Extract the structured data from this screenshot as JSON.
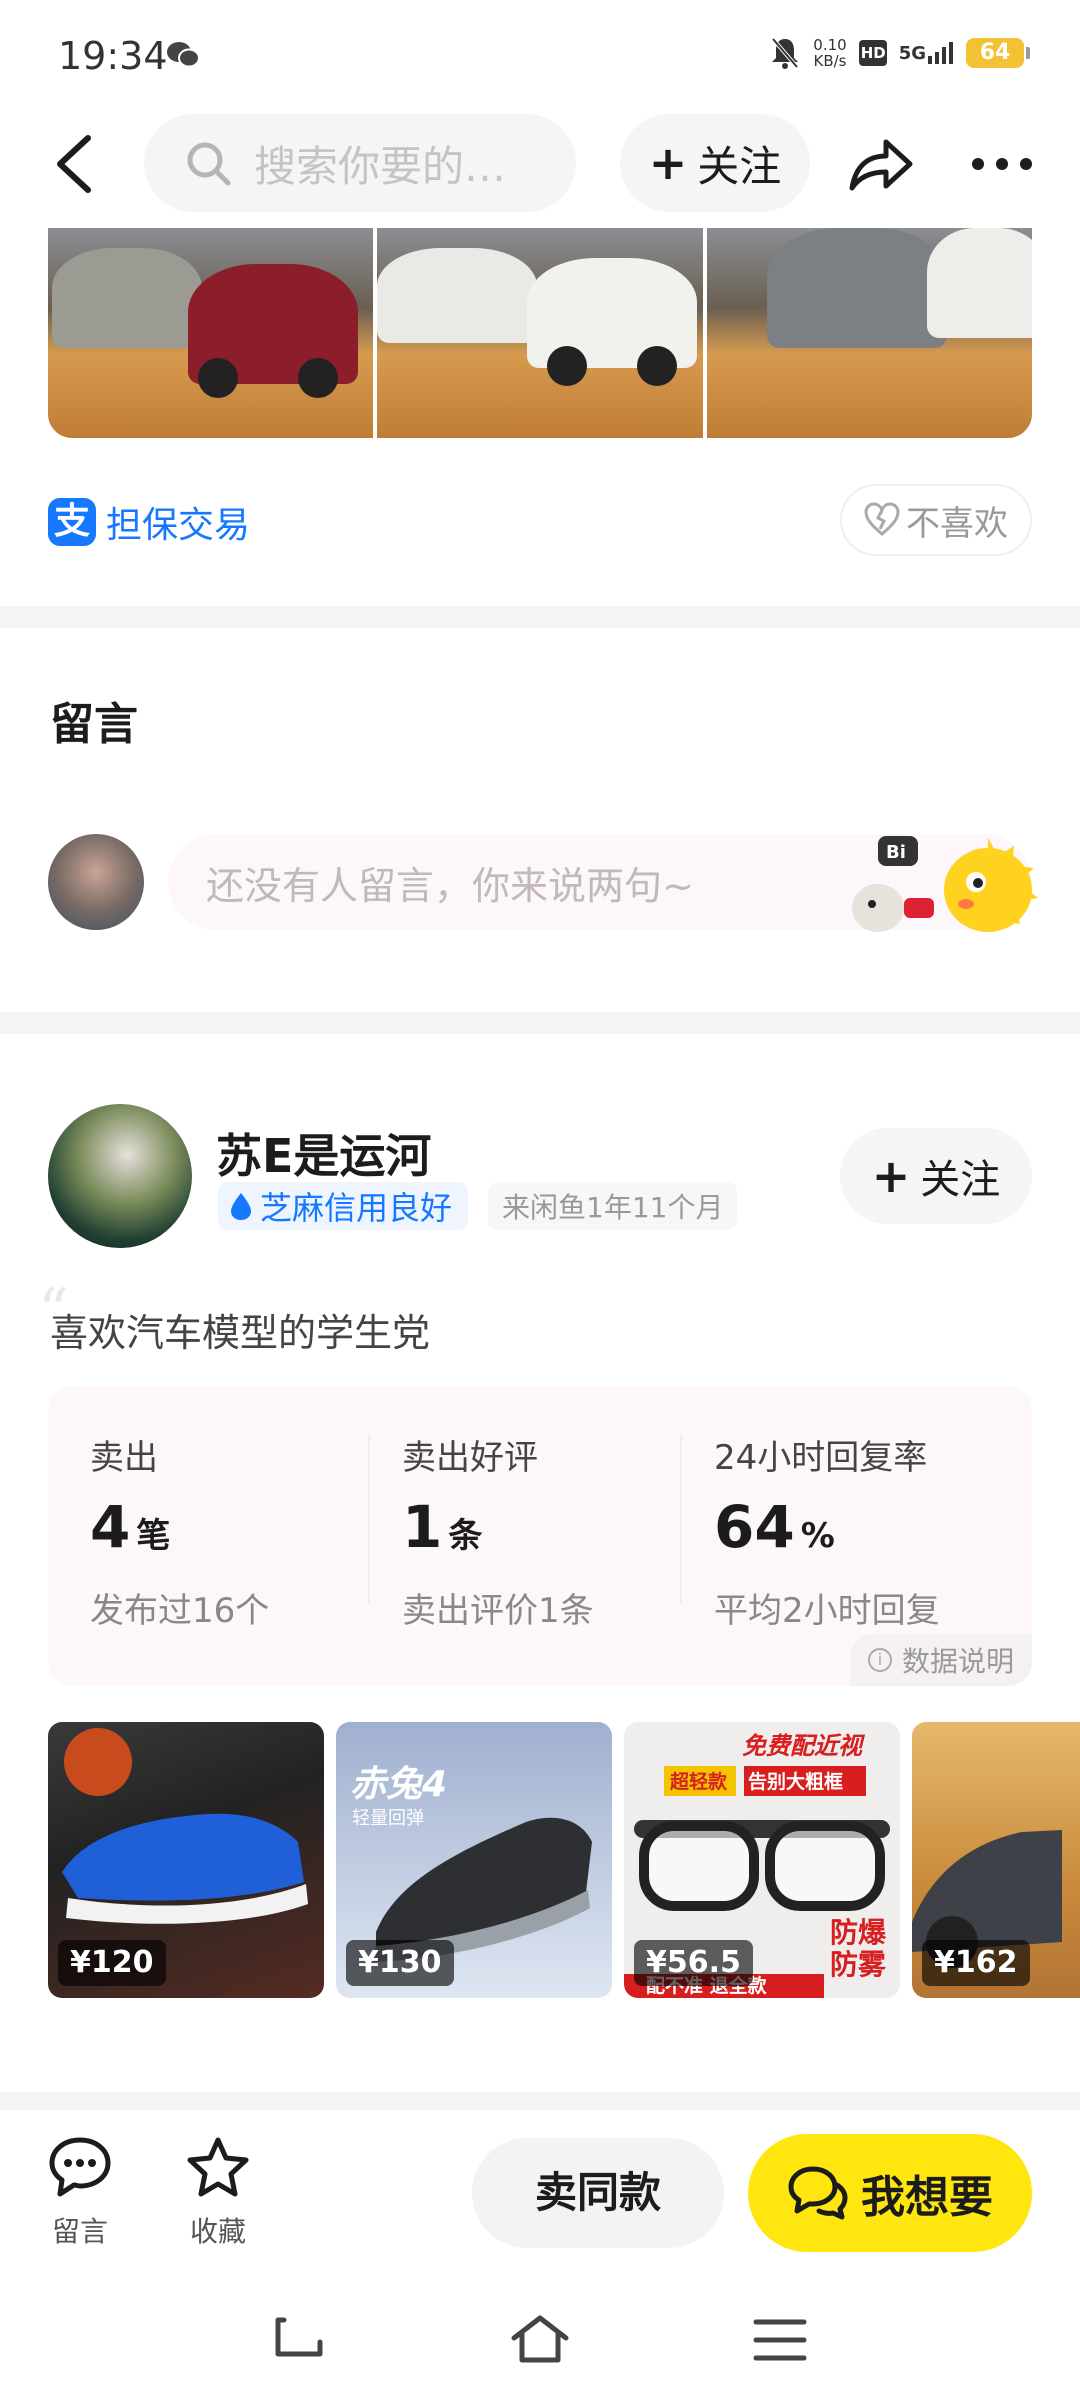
{
  "status": {
    "time": "19:34",
    "speed_top": "0.10",
    "speed_unit": "KB/s",
    "hd": "HD",
    "network": "5G",
    "battery": "64"
  },
  "nav": {
    "search_placeholder": "搜索你要的…",
    "follow_label": "关注"
  },
  "guarantee": {
    "label": "担保交易",
    "dislike_label": "不喜欢"
  },
  "comments": {
    "title": "留言",
    "input_placeholder": "还没有人留言，你来说两句~",
    "mascot_text": "Bi"
  },
  "seller": {
    "name": "苏E是运河",
    "credit": "芝麻信用良好",
    "since": "来闲鱼1年11个月",
    "follow_label": "关注",
    "bio": "喜欢汽车模型的学生党",
    "stats": [
      {
        "label": "卖出",
        "value": "4",
        "unit": "笔",
        "sub": "发布过16个"
      },
      {
        "label": "卖出好评",
        "value": "1",
        "unit": "条",
        "sub": "卖出评价1条"
      },
      {
        "label": "24小时回复率",
        "value": "64",
        "unit": "%",
        "sub": "平均2小时回复"
      }
    ],
    "explain_label": "数据说明",
    "goods": [
      {
        "price": "¥120"
      },
      {
        "price": "¥130",
        "text1": "赤兔4",
        "text2": "轻量回弹"
      },
      {
        "price": "¥56.5",
        "text1": "免费配近视",
        "text2": "超轻款",
        "text3": "告别大粗框",
        "text4": "防爆",
        "text5": "防雾",
        "text6": "配不准 退全款"
      },
      {
        "price": "¥162"
      }
    ]
  },
  "bottom": {
    "comment_label": "留言",
    "favorite_label": "收藏",
    "sell_same_label": "卖同款",
    "want_label": "我想要"
  },
  "colors": {
    "brand_yellow": "#ffe60f",
    "alipay_blue": "#1677ff"
  }
}
